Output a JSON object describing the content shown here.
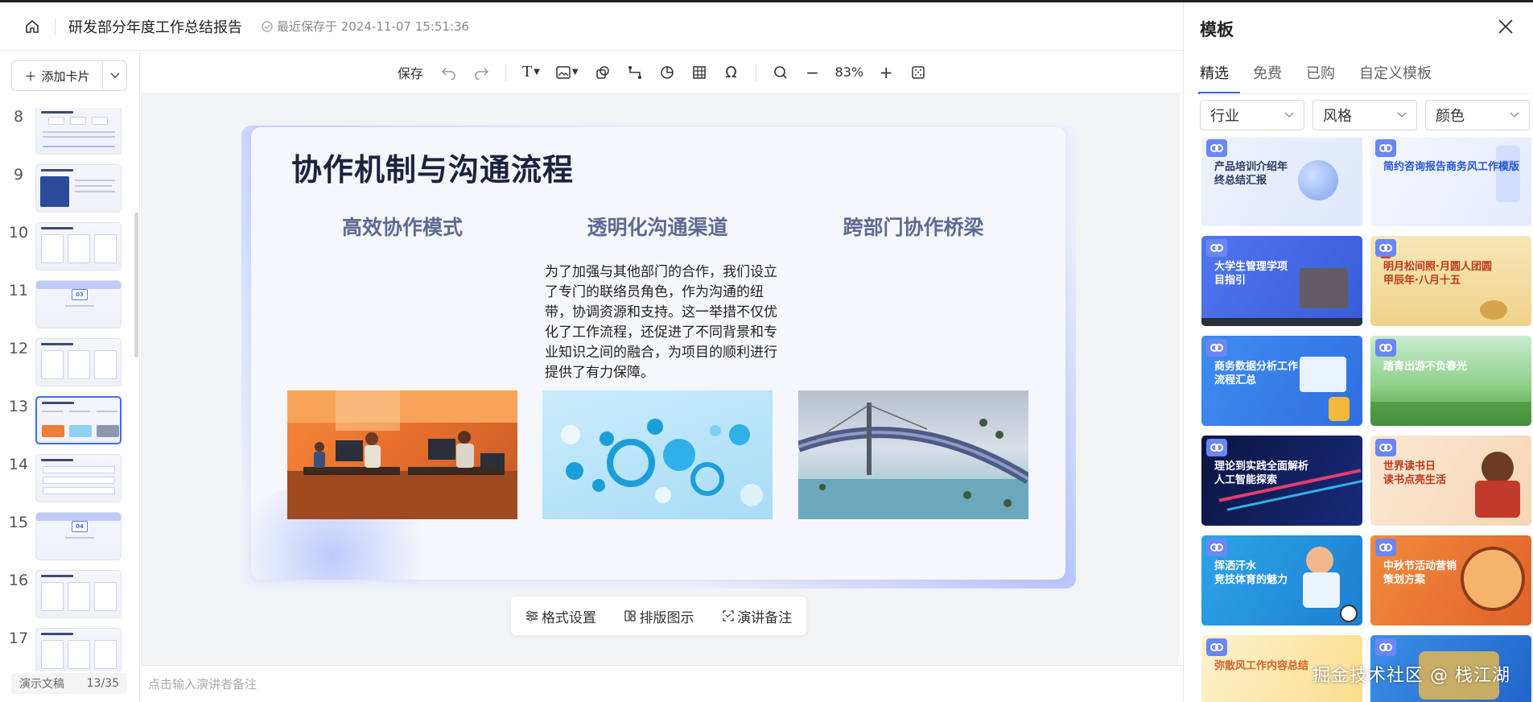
{
  "header": {
    "doc_title": "研发部分年度工作总结报告",
    "save_status": "最近保存于 2024-11-07 15:51:36"
  },
  "sidebar": {
    "add_card_label": "添加卡片",
    "slides": [
      {
        "num": "8",
        "layout": "grid3"
      },
      {
        "num": "9",
        "layout": "image"
      },
      {
        "num": "10",
        "layout": "cols"
      },
      {
        "num": "11",
        "layout": "section",
        "section": "03"
      },
      {
        "num": "12",
        "layout": "cols"
      },
      {
        "num": "13",
        "layout": "images3",
        "active": true
      },
      {
        "num": "14",
        "layout": "list"
      },
      {
        "num": "15",
        "layout": "section",
        "section": "04"
      },
      {
        "num": "16",
        "layout": "cols"
      },
      {
        "num": "17",
        "layout": "cols"
      }
    ],
    "footer_label": "演示文稿",
    "page_count": "13/35"
  },
  "toolbar": {
    "save_label": "保存",
    "zoom": "83%"
  },
  "slide": {
    "title": "协作机制与沟通流程",
    "col1_heading": "高效协作模式",
    "col2_heading": "透明化沟通渠道",
    "col3_heading": "跨部门协作桥梁",
    "col2_body": "为了加强与其他部门的合作，我们设立了专门的联络员角色，作为沟通的纽带，协调资源和支持。这一举措不仅优化了工作流程，还促进了不同背景和专业知识之间的融合，为项目的顺利进行提供了有力保障。"
  },
  "floating_bar": {
    "format_label": "格式设置",
    "layout_label": "排版图示",
    "notes_label": "演讲备注"
  },
  "notes_placeholder": "点击输入演讲者备注",
  "panel": {
    "title": "模板",
    "tabs": [
      "精选",
      "免费",
      "已购",
      "自定义模板"
    ],
    "filters": [
      "行业",
      "风格",
      "颜色"
    ],
    "templates": [
      {
        "title": "产品培训介绍年\n终总结汇报",
        "style": "light-blue"
      },
      {
        "title": "简约咨询报告商务风工作模版",
        "style": "light-blue2"
      },
      {
        "title": "大学生管理学项\n目指引",
        "style": "blue-law"
      },
      {
        "title": "明月松间照·月圆人团圆\n甲辰年·八月十五",
        "style": "mid-autumn"
      },
      {
        "title": "商务数据分析工作\n流程汇总",
        "style": "blue-data"
      },
      {
        "title": "踏青出游不负春光",
        "style": "green"
      },
      {
        "title": "理论到实践全面解析\n人工智能探索",
        "style": "dark-ai"
      },
      {
        "title": "世界读书日\n读书点亮生活",
        "style": "reading"
      },
      {
        "title": "挥洒汗水\n竞技体育的魅力",
        "style": "sports"
      },
      {
        "title": "中秋节活动营销\n策划方案",
        "style": "orange"
      },
      {
        "title": "弥散风工作内容总结",
        "style": "yellow"
      },
      {
        "title": "",
        "style": "blue-gold"
      }
    ],
    "watermark": "掘金技术社区 @ 栈江湖"
  },
  "colors": {
    "accent": "#3d6bf0",
    "slide_title": "#1c2340",
    "column_heading": "#5c6b93"
  }
}
